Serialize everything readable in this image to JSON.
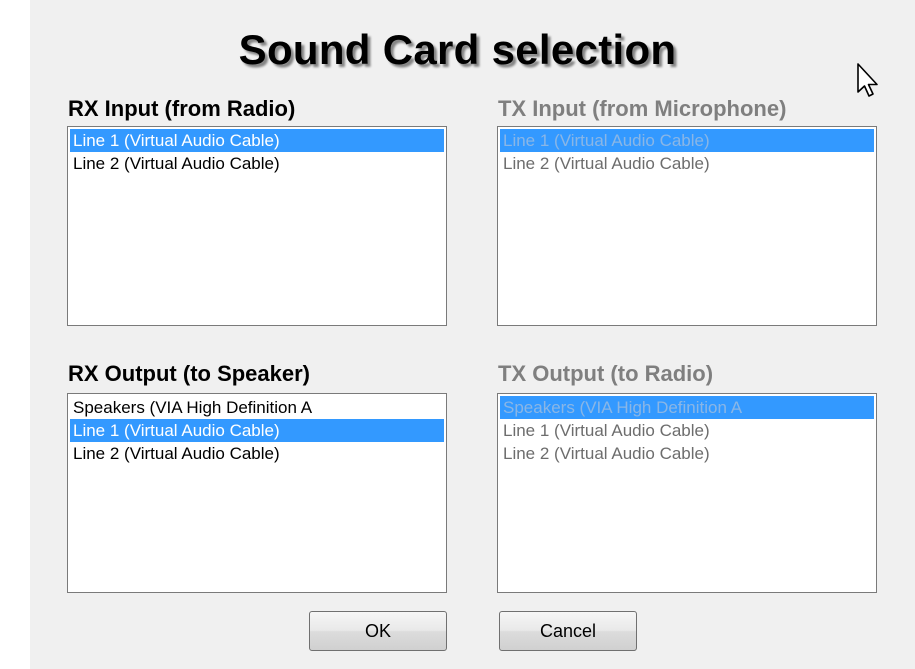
{
  "dialog": {
    "title": "Sound Card selection"
  },
  "rx_input": {
    "label": "RX Input (from Radio)",
    "enabled": true,
    "items": [
      {
        "label": "Line 1 (Virtual Audio Cable)",
        "selected": true
      },
      {
        "label": "Line 2 (Virtual Audio Cable)",
        "selected": false
      }
    ]
  },
  "tx_input": {
    "label": "TX Input (from Microphone)",
    "enabled": false,
    "items": [
      {
        "label": "Line 1 (Virtual Audio Cable)",
        "selected": true
      },
      {
        "label": "Line 2 (Virtual Audio Cable)",
        "selected": false
      }
    ]
  },
  "rx_output": {
    "label": "RX Output (to Speaker)",
    "enabled": true,
    "items": [
      {
        "label": "Speakers (VIA High Definition A",
        "selected": false
      },
      {
        "label": "Line 1 (Virtual Audio Cable)",
        "selected": true
      },
      {
        "label": "Line 2 (Virtual Audio Cable)",
        "selected": false
      }
    ]
  },
  "tx_output": {
    "label": "TX Output (to Radio)",
    "enabled": false,
    "items": [
      {
        "label": "Speakers (VIA High Definition A",
        "selected": true
      },
      {
        "label": "Line 1 (Virtual Audio Cable)",
        "selected": false
      },
      {
        "label": "Line 2 (Virtual Audio Cable)",
        "selected": false
      }
    ]
  },
  "buttons": {
    "ok_label": "OK",
    "cancel_label": "Cancel"
  },
  "colors": {
    "selection": "#3399ff",
    "dialog_background": "#f0f0f0",
    "disabled_text": "#7f7f7f"
  },
  "icons": {
    "cursor": "mouse-pointer-icon"
  }
}
